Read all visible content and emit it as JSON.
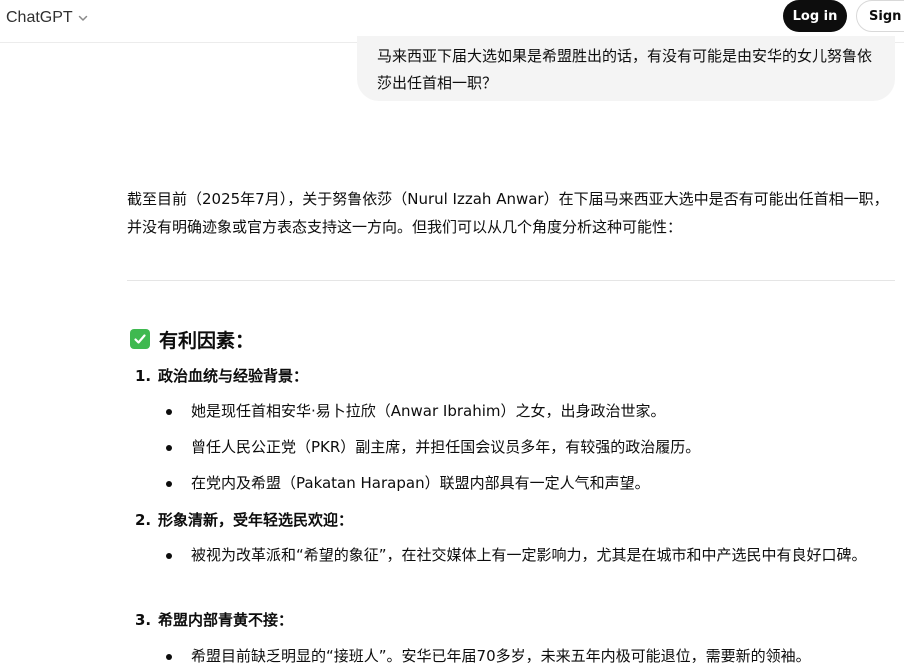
{
  "header": {
    "model_name": "ChatGPT",
    "login_label": "Log in",
    "signup_label": "Sign up"
  },
  "user_message": {
    "text": "马来西亚下届大选如果是希盟胜出的话，有没有可能是由安华的女儿努鲁依莎出任首相一职？"
  },
  "assistant": {
    "intro": "截至目前（2025年7月），关于努鲁依莎（Nurul Izzah Anwar）在下届马来西亚大选中是否有可能出任首相一职，并没有明确迹象或官方表态支持这一方向。但我们可以从几个角度分析这种可能性：",
    "section": {
      "emoji": "check-mark-button-icon",
      "title": "有利因素："
    },
    "items": [
      {
        "num": "1.",
        "title": "政治血统与经验背景：",
        "bullets": [
          "她是现任首相安华·易卜拉欣（Anwar Ibrahim）之女，出身政治世家。",
          "曾任人民公正党（PKR）副主席，并担任国会议员多年，有较强的政治履历。",
          "在党内及希盟（Pakatan Harapan）联盟内部具有一定人气和声望。"
        ]
      },
      {
        "num": "2.",
        "title": "形象清新，受年轻选民欢迎：",
        "bullets": [
          "被视为改革派和“希望的象征”，在社交媒体上有一定影响力，尤其是在城市和中产选民中有良好口碑。"
        ]
      },
      {
        "num": "3.",
        "title": "希盟内部青黄不接：",
        "bullets": [
          "希盟目前缺乏明显的“接班人”。安华已年届70多岁，未来五年内极可能退位，需要新的领袖。"
        ]
      }
    ]
  },
  "colors": {
    "accent_dark": "#0d0d0d",
    "bubble_bg": "#f4f4f4",
    "check_green": "#3fb950"
  }
}
